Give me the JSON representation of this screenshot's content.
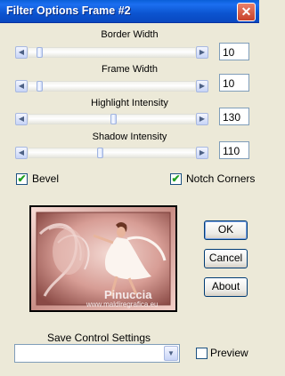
{
  "window": {
    "title": "Filter Options Frame #2",
    "close_glyph": "✕"
  },
  "sliders": [
    {
      "label": "Border Width",
      "value": "10",
      "level": 0.05
    },
    {
      "label": "Frame Width",
      "value": "10",
      "level": 0.05
    },
    {
      "label": "Highlight Intensity",
      "value": "130",
      "level": 0.51
    },
    {
      "label": "Shadow Intensity",
      "value": "110",
      "level": 0.43
    }
  ],
  "arrows": {
    "left": "◀",
    "right": "▶",
    "down": "▼"
  },
  "checkboxes": {
    "bevel": {
      "label": "Bevel",
      "checked": true,
      "mark": "✔"
    },
    "notch": {
      "label": "Notch Corners",
      "checked": true,
      "mark": "✔"
    },
    "preview": {
      "label": "Preview",
      "checked": false,
      "mark": ""
    }
  },
  "buttons": {
    "ok": "OK",
    "cancel": "Cancel",
    "about": "About"
  },
  "preview_image": {
    "watermark_name": "Pinuccia",
    "watermark_url": "www.maldiregrafica.eu"
  },
  "save": {
    "label": "Save Control Settings",
    "value": ""
  }
}
